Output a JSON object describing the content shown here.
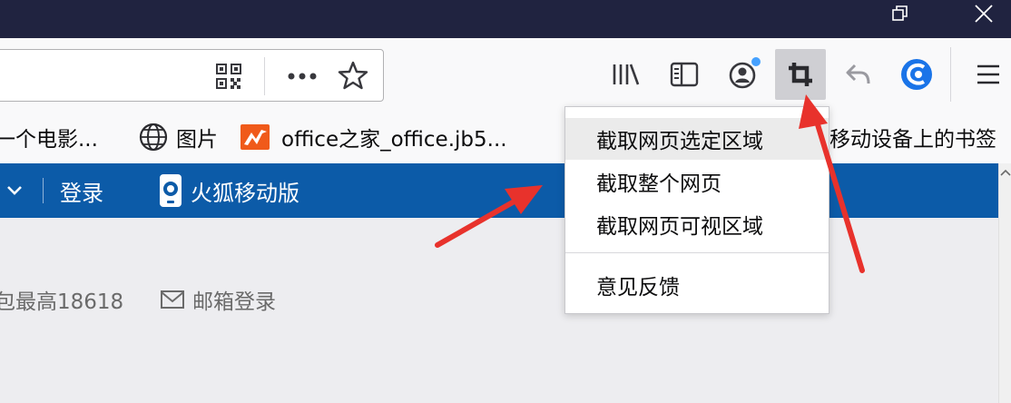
{
  "titlebar": {
    "buttons": [
      "restore-icon",
      "close-icon"
    ]
  },
  "navbar": {
    "url_icons": [
      "qr-code-icon",
      "more-icon",
      "star-icon"
    ],
    "toolbar_icons": [
      "library-icon",
      "sidebar-icon",
      "account-icon",
      "screenshot-crop-icon",
      "back-arrow-icon",
      "extension-icon",
      "menu-icon"
    ]
  },
  "bookmarks": {
    "items": [
      {
        "label": "一个电影...",
        "icon": ""
      },
      {
        "label": "图片",
        "icon": "globe-icon"
      },
      {
        "label": "office之家_office.jb5...",
        "icon": "office-icon"
      },
      {
        "label": "移动设备上的书签",
        "icon": ""
      }
    ]
  },
  "page": {
    "bluebar": {
      "login_label": "登录",
      "mobile_label": "火狐移动版"
    },
    "content": {
      "left_text": "包最高18618",
      "mail_login": "邮箱登录"
    }
  },
  "screenshot_menu": {
    "items": [
      "截取网页选定区域",
      "截取整个网页",
      "截取网页可视区域"
    ],
    "feedback": "意见反馈"
  },
  "colors": {
    "titlebar": "#202340",
    "toolbar": "#f9f9fa",
    "page_blue": "#0c5ba8",
    "annotation_red": "#e8322c",
    "account_dot": "#45a1ff"
  }
}
